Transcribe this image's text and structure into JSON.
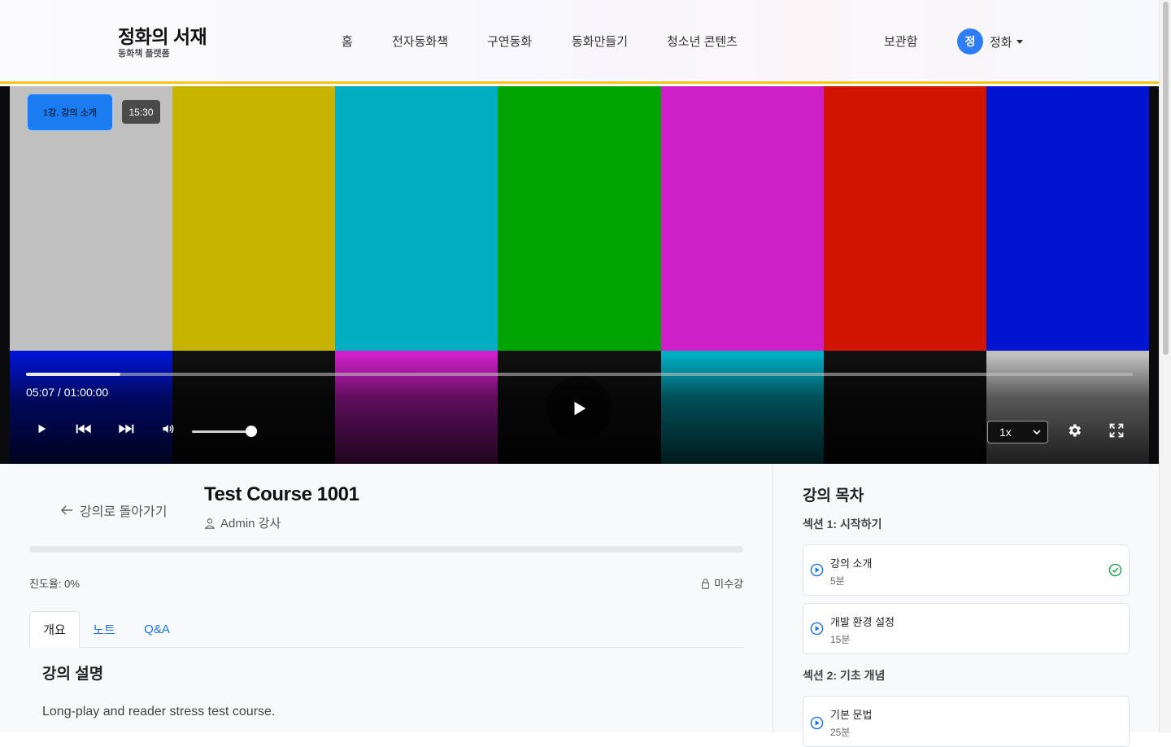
{
  "header": {
    "brand_title": "정화의 서재",
    "brand_subtitle": "동화책 플랫폼",
    "nav": [
      "홈",
      "전자동화책",
      "구연동화",
      "동화만들기",
      "청소년 콘텐츠"
    ],
    "archive": "보관함",
    "user": {
      "avatar_initial": "정",
      "name": "정화"
    }
  },
  "player": {
    "lesson_chip": "1강. 강의 소개",
    "duration_chip": "15:30",
    "time_display": "05:07 / 01:00:00",
    "progress_fraction": 0.085,
    "volume_fraction": 1.0,
    "speed": "1x",
    "speed_options": [
      "1x"
    ],
    "colors": {
      "bars": [
        "#c0c0c0",
        "#c6b400",
        "#00aec2",
        "#00a400",
        "#cf1fc8",
        "#d01400",
        "#0014d1"
      ],
      "strip": [
        "#0014d1",
        "#101010",
        "#cf1fc8",
        "#101010",
        "#00aec2",
        "#101010",
        "#c0c0c0"
      ]
    }
  },
  "course": {
    "back_label": "강의로 돌아가기",
    "title": "Test Course 1001",
    "instructor": "Admin 강사",
    "progress_label": "진도율: 0%",
    "progress_fraction": 0,
    "status": "미수강",
    "tabs": [
      "개요",
      "노트",
      "Q&A"
    ],
    "active_tab": "개요",
    "description_heading": "강의 설명",
    "description_text": "Long-play and reader stress test course."
  },
  "toc": {
    "title": "강의 목차",
    "sections": [
      {
        "title": "섹션 1: 시작하기",
        "lessons": [
          {
            "title": "강의 소개",
            "duration": "5분",
            "completed": true
          },
          {
            "title": "개발 환경 설정",
            "duration": "15분",
            "completed": false
          }
        ]
      },
      {
        "title": "섹션 2: 기초 개념",
        "lessons": [
          {
            "title": "기본 문법",
            "duration": "25분",
            "completed": false
          }
        ]
      }
    ]
  }
}
